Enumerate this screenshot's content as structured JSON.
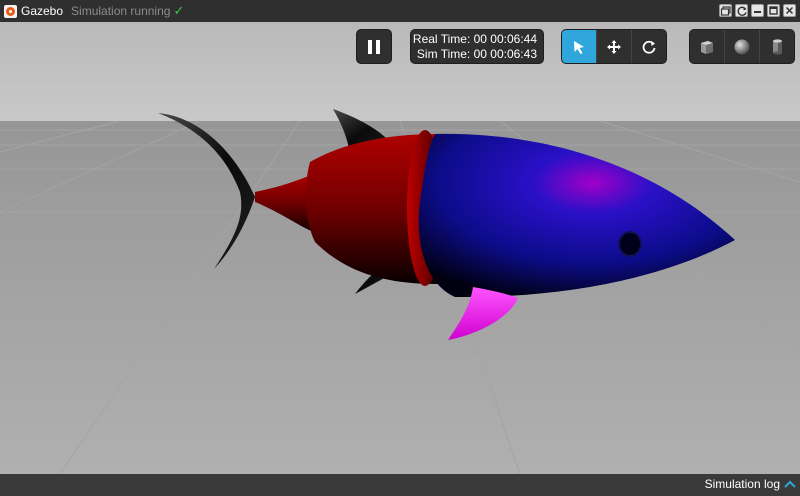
{
  "window": {
    "app_name": "Gazebo",
    "status_text": "Simulation running",
    "controls": [
      "restore-icon",
      "refresh-icon",
      "minimize-icon",
      "maximize-icon",
      "close-icon"
    ]
  },
  "toolbar": {
    "pause_icon": "pause-icon",
    "real_time": "Real Time: 00 00:06:44",
    "sim_time": "Sim Time: 00 00:06:43",
    "modes": [
      "select-arrow-icon",
      "translate-icon",
      "rotate-icon"
    ],
    "active_mode": "select",
    "shapes": [
      "box-icon",
      "sphere-icon",
      "cylinder-icon"
    ]
  },
  "statusbar": {
    "log_label": "Simulation log"
  },
  "colors": {
    "accent": "#2fa6dc",
    "status_ok": "#2ecc40",
    "fish_body_front": "#0a0aa8",
    "fish_body_rear": "#8a0000",
    "fin_pink": "#ff00ff"
  }
}
